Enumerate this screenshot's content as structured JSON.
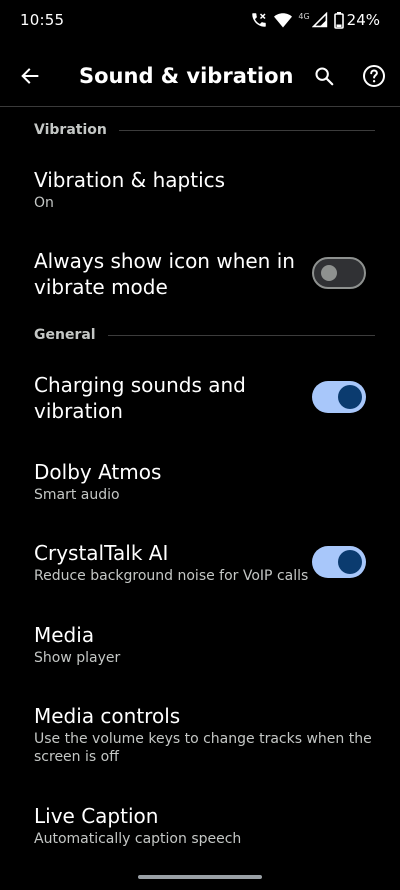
{
  "status_bar": {
    "time": "10:55",
    "network_label": "4G",
    "battery": "24%",
    "icons": [
      "wifi-calling-icon",
      "wifi-icon",
      "cell-signal-icon",
      "battery-icon"
    ]
  },
  "app_bar": {
    "title": "Sound & vibration",
    "back_icon": "arrow-back-icon",
    "search_icon": "search-icon",
    "help_icon": "help-icon"
  },
  "sections": {
    "vibration": {
      "title": "Vibration"
    },
    "general": {
      "title": "General"
    }
  },
  "items": {
    "vibration_haptics": {
      "title": "Vibration & haptics",
      "summary": "On"
    },
    "vibrate_icon": {
      "title": "Always show icon when in vibrate mode",
      "toggle": false
    },
    "charging_sounds": {
      "title": "Charging sounds and vibration",
      "toggle": true
    },
    "dolby_atmos": {
      "title": "Dolby Atmos",
      "summary": "Smart audio"
    },
    "crystaltalk": {
      "title": "CrystalTalk AI",
      "summary": "Reduce background noise for VoIP calls",
      "toggle": true
    },
    "media": {
      "title": "Media",
      "summary": "Show player"
    },
    "media_controls": {
      "title": "Media controls",
      "summary": "Use the volume keys to change tracks when the screen is off"
    },
    "live_caption": {
      "title": "Live Caption",
      "summary": "Automatically caption speech"
    }
  },
  "colors": {
    "background": "#000000",
    "toggle_on_track": "#a8c7fa",
    "toggle_on_thumb": "#0b3b6f",
    "toggle_off_track": "#303134",
    "toggle_off_outline": "#8e918f",
    "secondary_text": "#c4c7c5"
  }
}
